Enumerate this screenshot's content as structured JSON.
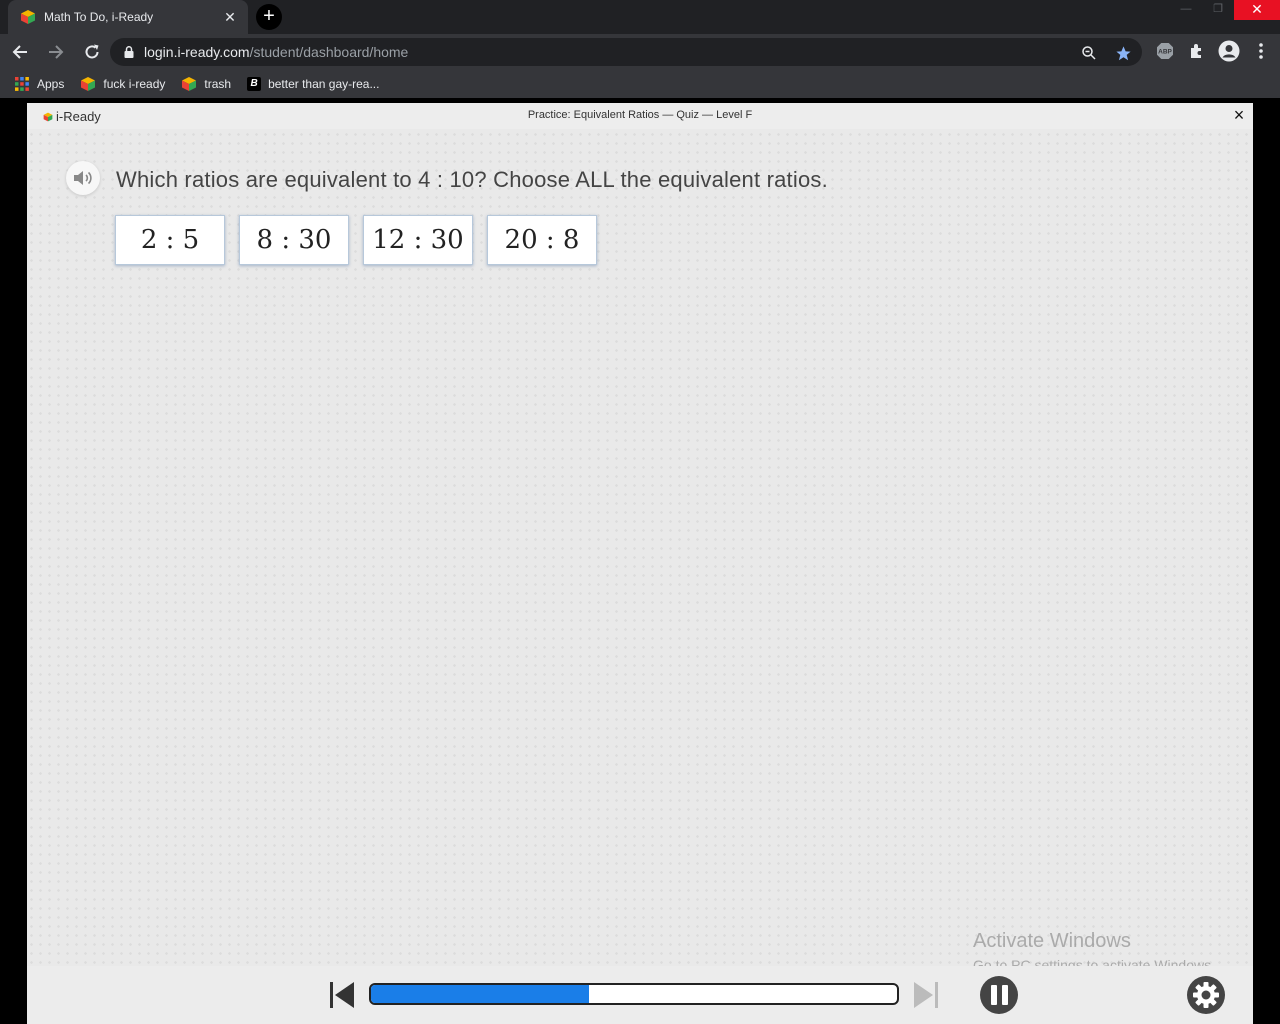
{
  "browser": {
    "tab": {
      "title": "Math To Do, i-Ready"
    },
    "omnibox": {
      "host": "login.i-ready.com",
      "path": "/student/dashboard/home"
    },
    "bookmarks": [
      {
        "label": "Apps",
        "icon": "apps-grid-icon"
      },
      {
        "label": "fuck i-ready",
        "icon": "iready-cube-icon"
      },
      {
        "label": "trash",
        "icon": "iready-cube-icon"
      },
      {
        "label": "better than gay-rea...",
        "icon": "b-letter-icon"
      }
    ],
    "extensions": {
      "abp_label": "ABP"
    }
  },
  "lesson": {
    "logo": "i-Ready",
    "title": "Practice: Equivalent Ratios — Quiz — Level F",
    "close_label": "×",
    "question": "Which ratios are equivalent to 4 : 10? Choose ALL the equivalent ratios.",
    "choices": [
      "2 : 5",
      "8 : 30",
      "12 : 30",
      "20 : 8"
    ],
    "progress_fraction": 0.415
  },
  "watermark": {
    "title": "Activate Windows",
    "subtitle": "Go to PC settings to activate Windows."
  },
  "colors": {
    "progress_fill": "#1a7ee8",
    "bookmark_star": "#8ab4f8"
  }
}
